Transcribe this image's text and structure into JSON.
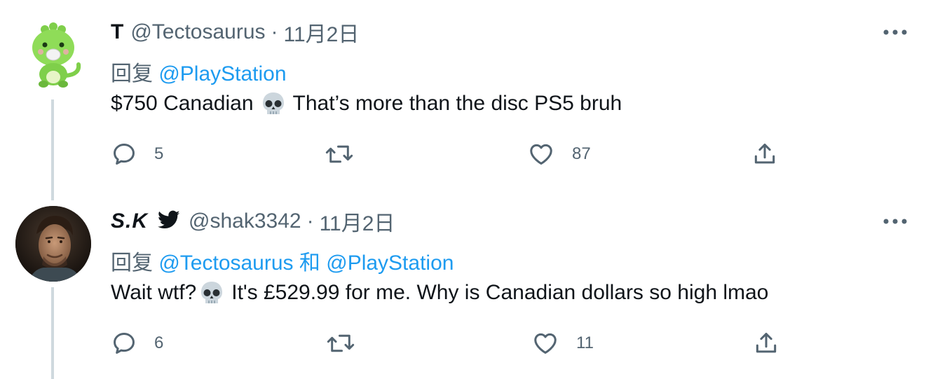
{
  "tweets": [
    {
      "display_name": "T",
      "handle": "@Tectosaurus",
      "separator": "·",
      "date": "11月2日",
      "reply_prefix": "回复",
      "reply_mentions": [
        "@PlayStation"
      ],
      "reply_joiner": "",
      "text_before": "$750 Canadian",
      "emoji": "skull",
      "text_after": "That’s more than the disc PS5 bruh",
      "reply_count": "5",
      "like_count": "87",
      "verified_icon": null,
      "avatar": "green-dinosaur-mascot"
    },
    {
      "display_name": "S.K",
      "handle": "@shak3342",
      "separator": "·",
      "date": "11月2日",
      "reply_prefix": "回复",
      "reply_mentions": [
        "@Tectosaurus",
        "@PlayStation"
      ],
      "reply_joiner": "和",
      "text_before": "Wait wtf?",
      "emoji": "skull",
      "text_after": "It's £529.99 for me. Why is Canadian dollars so high lmao",
      "reply_count": "6",
      "like_count": "11",
      "verified_icon": "bird-icon",
      "avatar": "man-portrait"
    }
  ],
  "colors": {
    "accent": "#1d9bf0",
    "text": "#0f1419",
    "muted": "#536471",
    "thread_line": "#cfd9de"
  }
}
